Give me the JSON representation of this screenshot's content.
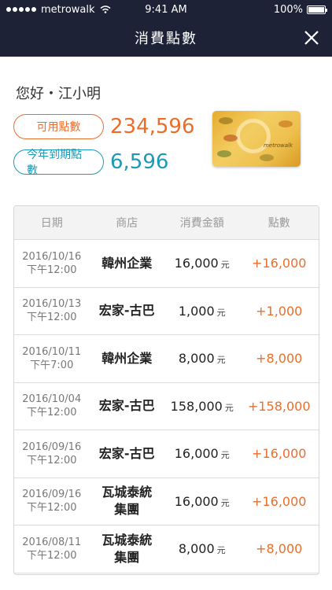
{
  "status_bar": {
    "carrier": "metrowalk",
    "time": "9:41 AM",
    "battery": "100%"
  },
  "nav": {
    "title": "消費點數"
  },
  "greeting": "您好・江小明",
  "available_points": {
    "label": "可用點數",
    "value": "234,596"
  },
  "expiring_points": {
    "label": "今年到期點數",
    "value": "6,596"
  },
  "table": {
    "headers": {
      "date": "日期",
      "store": "商店",
      "amount": "消費金額",
      "points": "點數"
    },
    "rows": [
      {
        "date": "2016/10/16",
        "time": "下午12:00",
        "store": "韓州企業",
        "store2": "",
        "amount": "16,000",
        "unit": "元",
        "points": "+16,000"
      },
      {
        "date": "2016/10/13",
        "time": "下午12:00",
        "store": "宏家-古巴",
        "store2": "",
        "amount": "1,000",
        "unit": "元",
        "points": "+1,000"
      },
      {
        "date": "2016/10/11",
        "time": "下午7:00",
        "store": "韓州企業",
        "store2": "",
        "amount": "8,000",
        "unit": "元",
        "points": "+8,000"
      },
      {
        "date": "2016/10/04",
        "time": "下午12:00",
        "store": "宏家-古巴",
        "store2": "",
        "amount": "158,000",
        "unit": "元",
        "points": "+158,000"
      },
      {
        "date": "2016/09/16",
        "time": "下午12:00",
        "store": "宏家-古巴",
        "store2": "",
        "amount": "16,000",
        "unit": "元",
        "points": "+16,000"
      },
      {
        "date": "2016/09/16",
        "time": "下午12:00",
        "store": "瓦城泰統",
        "store2": "集團",
        "amount": "16,000",
        "unit": "元",
        "points": "+16,000"
      },
      {
        "date": "2016/08/11",
        "time": "下午12:00",
        "store": "瓦城泰統",
        "store2": "集團",
        "amount": "8,000",
        "unit": "元",
        "points": "+8,000"
      }
    ]
  },
  "colors": {
    "nav_bg": "#1d2236",
    "accent_orange": "#ec6d2a",
    "accent_teal": "#1b9ab6"
  },
  "icons": {
    "close": "close-icon",
    "wifi": "wifi-icon",
    "battery": "battery-icon"
  }
}
